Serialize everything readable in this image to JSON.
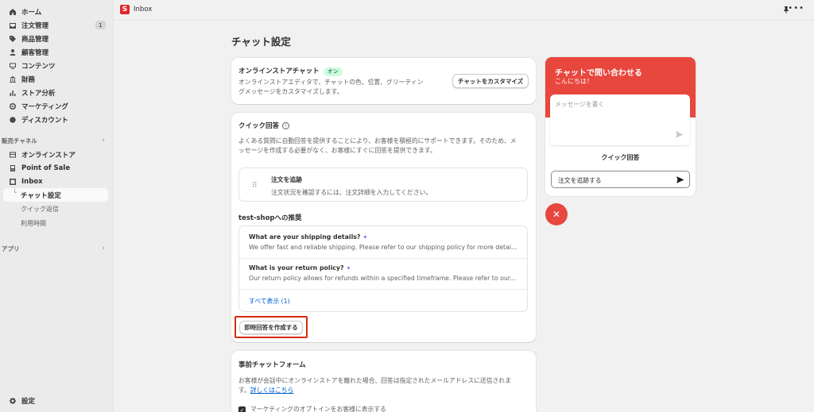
{
  "sidebar": {
    "items": [
      {
        "label": "ホーム",
        "icon": "home-icon"
      },
      {
        "label": "注文管理",
        "icon": "inbox-tray-icon",
        "badge": "1"
      },
      {
        "label": "商品管理",
        "icon": "tag-icon"
      },
      {
        "label": "顧客管理",
        "icon": "person-icon"
      },
      {
        "label": "コンテンツ",
        "icon": "monitor-icon"
      },
      {
        "label": "財務",
        "icon": "bank-icon"
      },
      {
        "label": "ストア分析",
        "icon": "bar-chart-icon"
      },
      {
        "label": "マーケティング",
        "icon": "target-icon"
      },
      {
        "label": "ディスカウント",
        "icon": "discount-gear-icon"
      }
    ],
    "sales_channels_label": "販売チャネル",
    "channels": [
      {
        "label": "オンラインストア",
        "icon": "store-icon"
      },
      {
        "label": "Point of Sale",
        "icon": "pos-icon"
      },
      {
        "label": "Inbox",
        "icon": "inbox-app-icon"
      }
    ],
    "inbox_sub": {
      "active": "チャット設定",
      "items": [
        "クイック返信",
        "利用時間"
      ]
    },
    "apps_label": "アプリ",
    "settings_label": "設定"
  },
  "topbar": {
    "logo_letter": "S",
    "title": "Inbox"
  },
  "page": {
    "title": "チャット設定"
  },
  "online_chat": {
    "title": "オンラインストアチャット",
    "status": "オン",
    "desc_line1": "オンラインストアエディタで、チャットの色、位置、グリーティン",
    "desc_line2": "グメッセージをカスタマイズします。",
    "customize_button": "チャットをカスタマイズ"
  },
  "quick_reply": {
    "title": "クイック回答",
    "info": "i",
    "desc_line1": "よくある質問に自動回答を提供することにより、お客様を積極的にサポートできます。そのため、メ",
    "desc_line2": "ッセージを作成する必要がなく、お客様にすぐに回答を提供できます。",
    "track": {
      "title": "注文を追跡",
      "text": "注文状況を確認するには、注文詳細を入力してください。"
    },
    "recommend_title": "test-shopへの推奨",
    "questions": [
      {
        "q": "What are your shipping details?",
        "a": "We offer fast and reliable shipping. Please refer to our shipping policy for more detai..."
      },
      {
        "q": "What is your return policy?",
        "a": "Our return policy allows for refunds within a specified timeframe. Please refer to our..."
      }
    ],
    "show_all": "すべて表示 (1)",
    "create_button": "即時回答を作成する"
  },
  "prechat": {
    "title": "事前チャットフォーム",
    "desc_line1": "お客様が会話中にオンラインストアを離れた場合、回答は指定されたメールアドレスに送信されま",
    "desc_line2_prefix": "す。",
    "learn_more": "詳しくはこちら",
    "checkbox_label": "マーケティングのオプトインをお客様に表示する"
  },
  "preview": {
    "header_title": "チャットで問い合わせる",
    "greeting": "こんにちは！",
    "message_placeholder": "メッセージを書く",
    "quick_label": "クイック回答",
    "quick_option": "注文を追跡する",
    "close_symbol": "✕"
  },
  "colors": {
    "chat_accent": "#e8473e",
    "highlight": "#d82c0d",
    "link": "#005bd3",
    "on_badge_bg": "#cdfee1"
  }
}
